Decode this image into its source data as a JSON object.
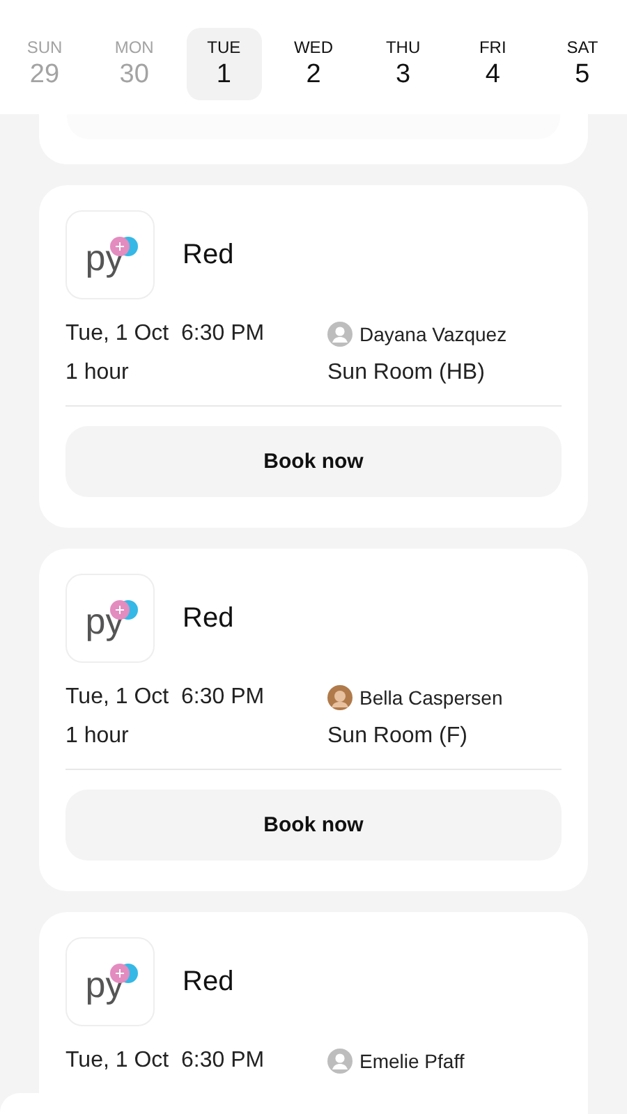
{
  "days": [
    {
      "weekday": "SUN",
      "date": "29",
      "past": true,
      "selected": false
    },
    {
      "weekday": "MON",
      "date": "30",
      "past": true,
      "selected": false
    },
    {
      "weekday": "TUE",
      "date": "1",
      "past": false,
      "selected": true
    },
    {
      "weekday": "WED",
      "date": "2",
      "past": false,
      "selected": false
    },
    {
      "weekday": "THU",
      "date": "3",
      "past": false,
      "selected": false
    },
    {
      "weekday": "FRI",
      "date": "4",
      "past": false,
      "selected": false
    },
    {
      "weekday": "SAT",
      "date": "5",
      "past": false,
      "selected": false
    }
  ],
  "classes": [
    {
      "logo_text": "py",
      "title": "Red",
      "datetime": "Tue, 1 Oct",
      "time": "6:30 PM",
      "instructor": "Dayana Vazquez",
      "avatar": {
        "kind": "placeholder"
      },
      "duration": "1 hour",
      "room": "Sun Room (HB)",
      "button": "Book now"
    },
    {
      "logo_text": "py",
      "title": "Red",
      "datetime": "Tue, 1 Oct",
      "time": "6:30 PM",
      "instructor": "Bella Caspersen",
      "avatar": {
        "kind": "photo"
      },
      "duration": "1 hour",
      "room": "Sun Room (F)",
      "button": "Book now"
    },
    {
      "logo_text": "py",
      "title": "Red",
      "datetime": "Tue, 1 Oct",
      "time": "6:30 PM",
      "instructor": "Emelie Pfaff",
      "avatar": {
        "kind": "placeholder"
      }
    }
  ]
}
